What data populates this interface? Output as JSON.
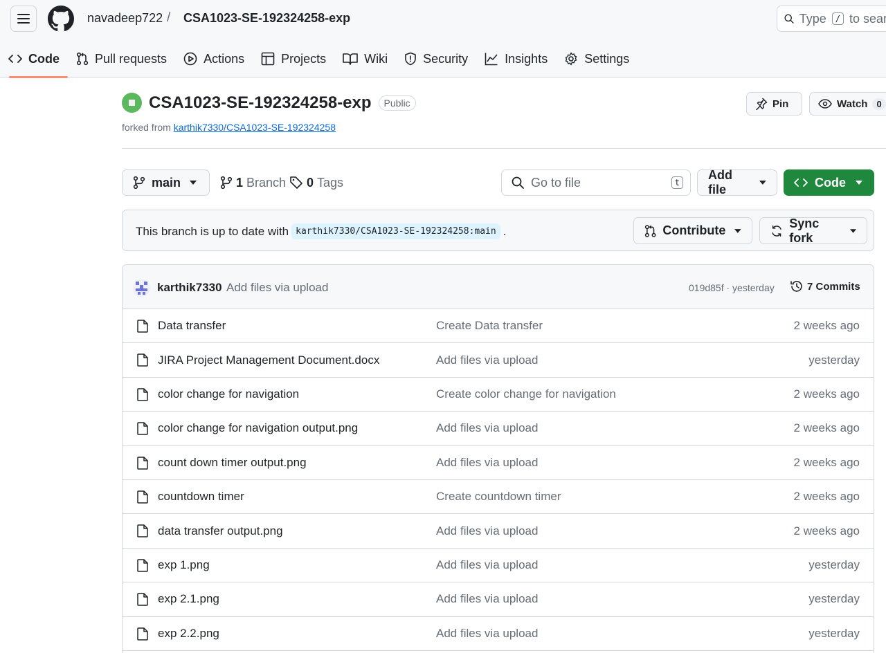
{
  "header": {
    "owner": "navadeep722",
    "separator": "/",
    "repo": "CSA1023-SE-192324258-exp",
    "search_label_prefix": "Type",
    "search_kbd": "/",
    "search_label_suffix": "to search"
  },
  "tabs": [
    {
      "label": "Code",
      "icon": "code-icon",
      "active": true
    },
    {
      "label": "Pull requests",
      "icon": "pull-request-icon"
    },
    {
      "label": "Actions",
      "icon": "play-icon"
    },
    {
      "label": "Projects",
      "icon": "table-icon"
    },
    {
      "label": "Wiki",
      "icon": "book-icon"
    },
    {
      "label": "Security",
      "icon": "shield-icon"
    },
    {
      "label": "Insights",
      "icon": "graph-icon"
    },
    {
      "label": "Settings",
      "icon": "gear-icon"
    }
  ],
  "repo": {
    "title": "CSA1023-SE-192324258-exp",
    "visibility": "Public",
    "forked_prefix": "forked from",
    "forked_from": "karthik7330/CSA1023-SE-192324258",
    "pin_label": "Pin",
    "watch_label": "Watch",
    "watch_count": "0"
  },
  "toolbar": {
    "branch": "main",
    "branch_count": "1",
    "branch_label": "Branch",
    "tag_count": "0",
    "tag_label": "Tags",
    "goto_placeholder": "Go to file",
    "goto_kbd": "t",
    "add_file": "Add file",
    "code": "Code"
  },
  "sync": {
    "message": "This branch is up to date with",
    "ref": "karthik7330/CSA1023-SE-192324258:main",
    "suffix": ".",
    "contribute": "Contribute",
    "sync_fork": "Sync fork"
  },
  "latest_commit": {
    "author": "karthik7330",
    "message": "Add files via upload",
    "sha_time": "019d85f · yesterday",
    "commits": "7 Commits"
  },
  "files": [
    {
      "name": "Data transfer",
      "message": "Create Data transfer",
      "time": "2 weeks ago"
    },
    {
      "name": "JIRA Project Management Document.docx",
      "message": "Add files via upload",
      "time": "yesterday"
    },
    {
      "name": "color change for navigation",
      "message": "Create color change for navigation",
      "time": "2 weeks ago"
    },
    {
      "name": "color change for navigation output.png",
      "message": "Add files via upload",
      "time": "2 weeks ago"
    },
    {
      "name": "count down timer output.png",
      "message": "Add files via upload",
      "time": "2 weeks ago"
    },
    {
      "name": "countdown timer",
      "message": "Create countdown timer",
      "time": "2 weeks ago"
    },
    {
      "name": "data transfer output.png",
      "message": "Add files via upload",
      "time": "2 weeks ago"
    },
    {
      "name": "exp 1.png",
      "message": "Add files via upload",
      "time": "yesterday"
    },
    {
      "name": "exp 2.1.png",
      "message": "Add files via upload",
      "time": "yesterday"
    },
    {
      "name": "exp 2.2.png",
      "message": "Add files via upload",
      "time": "yesterday"
    }
  ],
  "colors": {
    "accent_green": "#1f883d",
    "link_blue": "#0969da",
    "tab_underline": "#fd8c73"
  }
}
